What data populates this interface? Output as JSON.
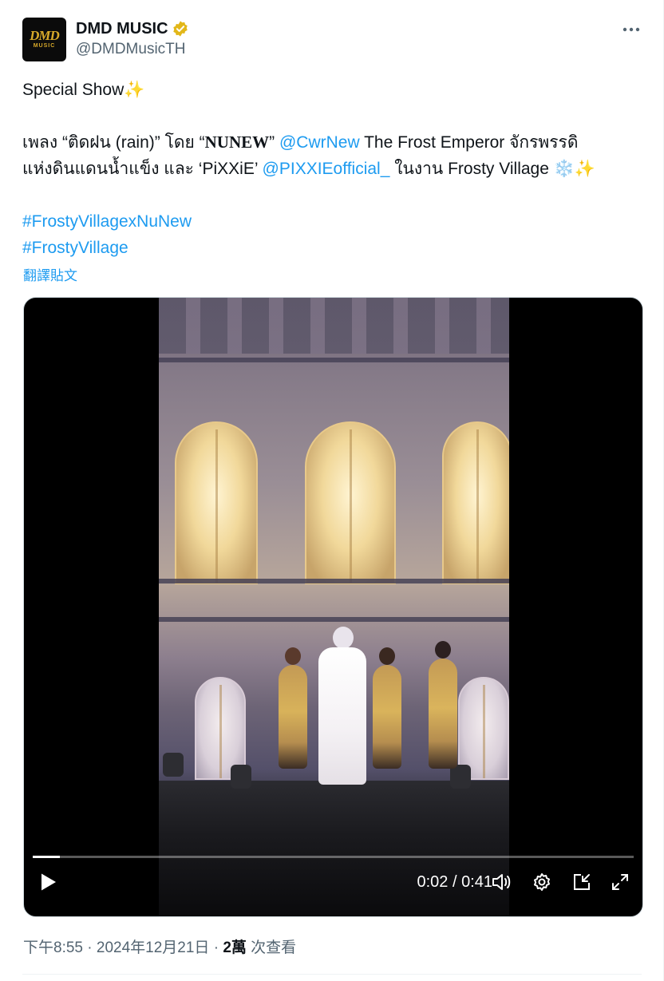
{
  "author": {
    "display_name": "DMD MUSIC",
    "handle": "@DMDMusicTH",
    "verified": true,
    "avatar_logo": "DMD",
    "avatar_sub": "MUSIC"
  },
  "tweet": {
    "line1": "Special Show",
    "line1_emoji": "✨",
    "line2_a": "เพลง “ติดฝน (rain)” โดย “",
    "line2_b": "NUNEW",
    "line2_c": "” ",
    "mention1": "@CwrNew",
    "line2_d": " The Frost Emperor จักรพรรดิ",
    "line3_a": "แห่งดินแดนน้ำแข็ง และ ‘PiXXiE’ ",
    "mention2": "@PIXXIEofficial_",
    "line3_b": " ในงาน Frosty Village ",
    "line3_emoji": "❄️✨",
    "hashtag1": "#FrostyVillagexNuNew",
    "hashtag2": "#FrostyVillage",
    "translate_label": "翻譯貼文"
  },
  "video": {
    "current_time": "0:02",
    "separator": " / ",
    "duration": "0:41",
    "progress_fraction": 0.045
  },
  "footer": {
    "time": "下午8:55",
    "dot1": " · ",
    "date": "2024年12月21日",
    "dot2": " · ",
    "views": "2萬",
    "views_label": " 次查看"
  },
  "colors": {
    "link": "#1d9bf0",
    "verified_badge": "#e2b719",
    "secondary_text": "#536471"
  },
  "icons": [
    "verified-badge-icon",
    "more-icon",
    "play-icon",
    "volume-icon",
    "settings-icon",
    "pip-icon",
    "fullscreen-icon"
  ]
}
